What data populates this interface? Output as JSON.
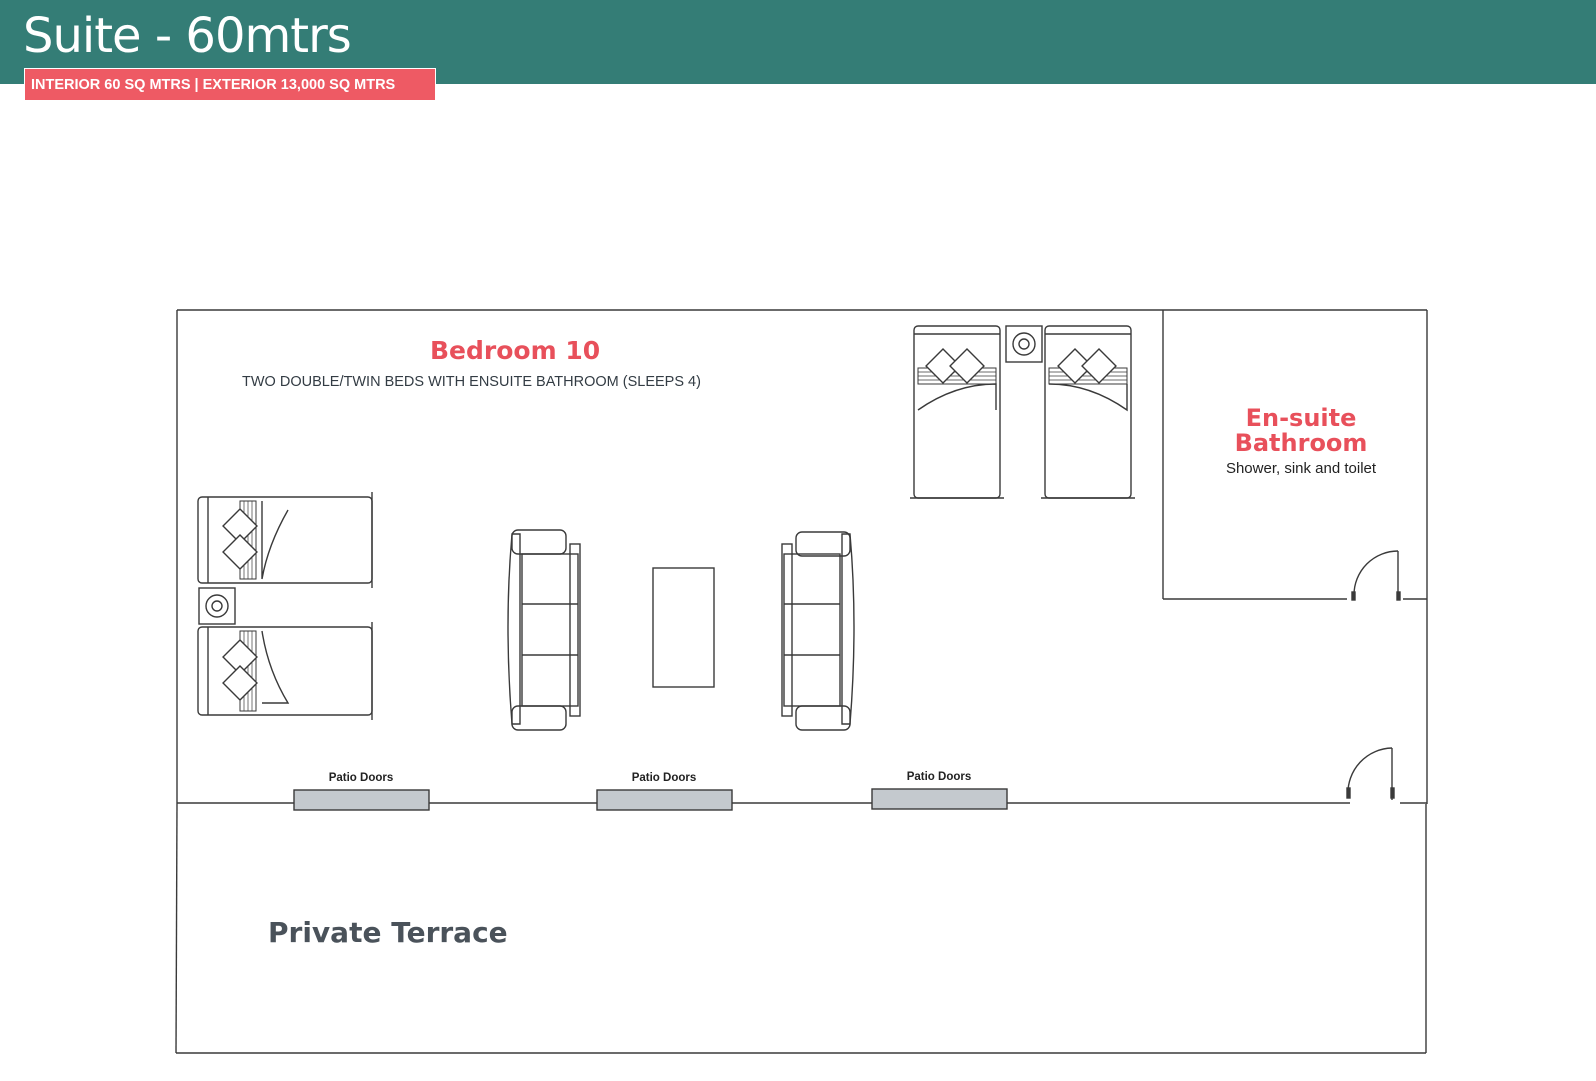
{
  "header": {
    "title": "Suite - 60mtrs",
    "badge": "INTERIOR 60 SQ MTRS | EXTERIOR 13,000 SQ MTRS",
    "bg_color": "#347d76",
    "badge_color": "#ee5a64"
  },
  "plan": {
    "bedroom": {
      "title": "Bedroom 10",
      "subtitle": "TWO DOUBLE/TWIN BEDS WITH ENSUITE BATHROOM (SLEEPS 4)"
    },
    "bathroom": {
      "title_line1": "En-suite",
      "title_line2": "Bathroom",
      "subtitle": "Shower, sink and toilet"
    },
    "patio_doors": [
      "Patio Doors",
      "Patio Doors",
      "Patio Doors"
    ],
    "terrace": "Private Terrace",
    "accent_color": "#e8505b"
  }
}
